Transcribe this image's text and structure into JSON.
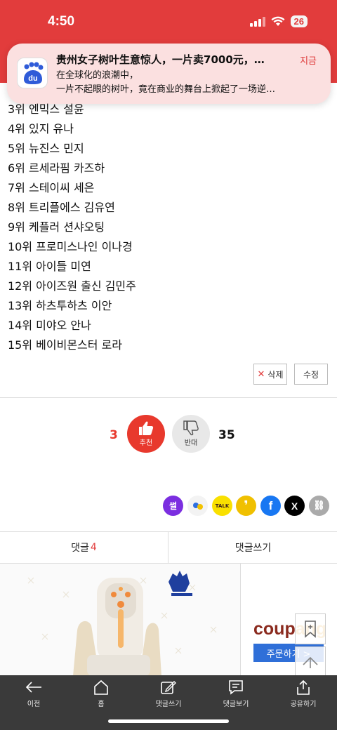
{
  "status": {
    "time": "4:50",
    "battery": "26"
  },
  "notification": {
    "app": "du",
    "title": "贵州女子树叶生意惊人，一片卖7000元，…",
    "time": "지금",
    "line1": "在全球化的浪潮中，",
    "line2": "一片不起眼的树叶，竟在商业的舞台上掀起了一场逆…"
  },
  "ranking": [
    "3위 엔믹스 설윤",
    "4위 있지 유나",
    "5위 뉴진스 민지",
    "6위 르세라핌 카즈하",
    "7위 스테이씨 세은",
    "8위 트리플에스 김유연",
    "9위 케플러 션샤오팅",
    "10위 프로미스나인 이나경",
    "11위 아이들 미연",
    "12위 아이즈원 출신 김민주",
    "13위 하츠투하츠 이안",
    "14위 미야오 안나",
    "15위 베이비몬스터 로라"
  ],
  "actions": {
    "delete_icon": "✕",
    "delete_label": "삭제",
    "edit_label": "수정"
  },
  "votes": {
    "up_count": "3",
    "up_label": "추천",
    "down_label": "반대",
    "down_count": "35",
    "up_color": "#e8392d",
    "down_color": "#e8e8e8"
  },
  "share": {
    "items": [
      {
        "name": "ssul",
        "label": "썰",
        "color": "#7b2ee0"
      },
      {
        "name": "dots",
        "label": "",
        "color": "#f3f3f3"
      },
      {
        "name": "kakaotalk",
        "label": "TALK",
        "color": "#f9e000"
      },
      {
        "name": "kakaostory",
        "label": "❜",
        "color": "#f0c000"
      },
      {
        "name": "facebook",
        "label": "f",
        "color": "#1877f2"
      },
      {
        "name": "x",
        "label": "X",
        "color": "#000000"
      },
      {
        "name": "link",
        "label": "⛓",
        "color": "#aaaaaa"
      }
    ]
  },
  "comments": {
    "tab_label": "댓글",
    "tab_count": "4",
    "write_label": "댓글쓰기"
  },
  "ad": {
    "brand_a": "coup",
    "brand_b": "ang",
    "order_button": "주문하기 >"
  },
  "bottom_nav": [
    {
      "icon": "back-arrow-icon",
      "label": "이전"
    },
    {
      "icon": "home-icon",
      "label": "홈"
    },
    {
      "icon": "write-comment-icon",
      "label": "댓글쓰기"
    },
    {
      "icon": "view-comments-icon",
      "label": "댓글보기"
    },
    {
      "icon": "share-icon",
      "label": "공유하기"
    }
  ]
}
